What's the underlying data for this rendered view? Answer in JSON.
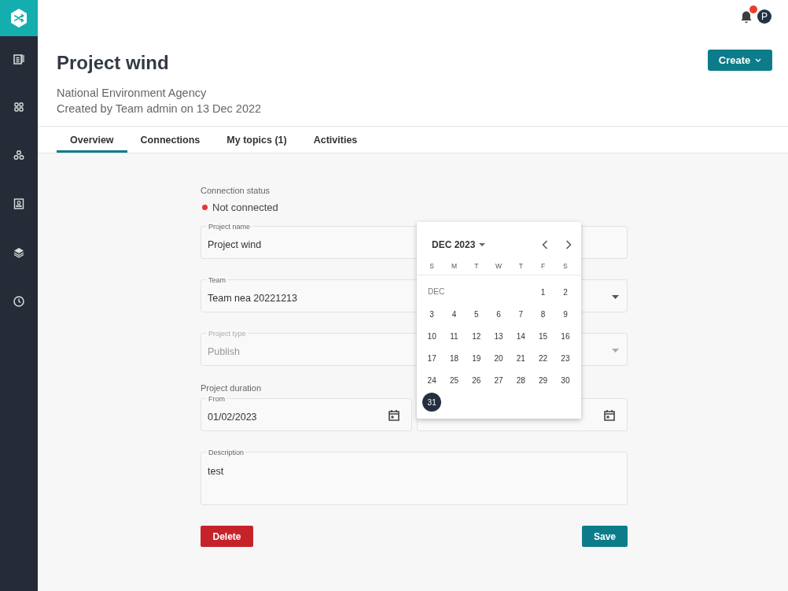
{
  "header": {
    "title": "Project wind",
    "organization": "National Environment Agency",
    "created": "Created by Team admin on 13 Dec 2022",
    "create_button": "Create",
    "avatar": "P",
    "has_notification": true
  },
  "tabs": [
    {
      "label": "Overview",
      "selected": true
    },
    {
      "label": "Connections",
      "selected": false
    },
    {
      "label": "My topics (1)",
      "selected": false
    },
    {
      "label": "Activities",
      "selected": false
    }
  ],
  "connection": {
    "label": "Connection status",
    "status": "Not connected",
    "color": "#e53935"
  },
  "fields": [
    {
      "label": "Project name",
      "value": "Project wind",
      "kind": "text",
      "disabled": false
    },
    {
      "label": "Team",
      "value": "Team nea 20221213",
      "kind": "select",
      "disabled": false
    },
    {
      "label": "Project type",
      "value": "Publish",
      "kind": "select",
      "disabled": true
    }
  ],
  "duration": {
    "label": "Project duration",
    "from_label": "From",
    "from_value": "01/02/2023"
  },
  "description": {
    "label": "Description",
    "value": "test"
  },
  "buttons": {
    "delete": "Delete",
    "save": "Save"
  },
  "calendar": {
    "title": "DEC 2023",
    "month_label": "DEC",
    "weekdays": [
      "S",
      "M",
      "T",
      "W",
      "T",
      "F",
      "S"
    ],
    "weeks": [
      [
        {
          "label": "1",
          "selected": false
        },
        {
          "label": "2",
          "selected": false
        }
      ],
      [
        {
          "label": "3",
          "selected": false
        },
        {
          "label": "4",
          "selected": false
        },
        {
          "label": "5",
          "selected": false
        },
        {
          "label": "6",
          "selected": false
        },
        {
          "label": "7",
          "selected": false
        },
        {
          "label": "8",
          "selected": false
        },
        {
          "label": "9",
          "selected": false
        }
      ],
      [
        {
          "label": "10",
          "selected": false
        },
        {
          "label": "11",
          "selected": false
        },
        {
          "label": "12",
          "selected": false
        },
        {
          "label": "13",
          "selected": false
        },
        {
          "label": "14",
          "selected": false
        },
        {
          "label": "15",
          "selected": false
        },
        {
          "label": "16",
          "selected": false
        }
      ],
      [
        {
          "label": "17",
          "selected": false
        },
        {
          "label": "18",
          "selected": false
        },
        {
          "label": "19",
          "selected": false
        },
        {
          "label": "20",
          "selected": false
        },
        {
          "label": "21",
          "selected": false
        },
        {
          "label": "22",
          "selected": false
        },
        {
          "label": "23",
          "selected": false
        }
      ],
      [
        {
          "label": "24",
          "selected": false
        },
        {
          "label": "25",
          "selected": false
        },
        {
          "label": "26",
          "selected": false
        },
        {
          "label": "27",
          "selected": false
        },
        {
          "label": "28",
          "selected": false
        },
        {
          "label": "29",
          "selected": false
        },
        {
          "label": "30",
          "selected": false
        }
      ],
      [
        {
          "label": "31",
          "selected": true
        }
      ]
    ]
  }
}
